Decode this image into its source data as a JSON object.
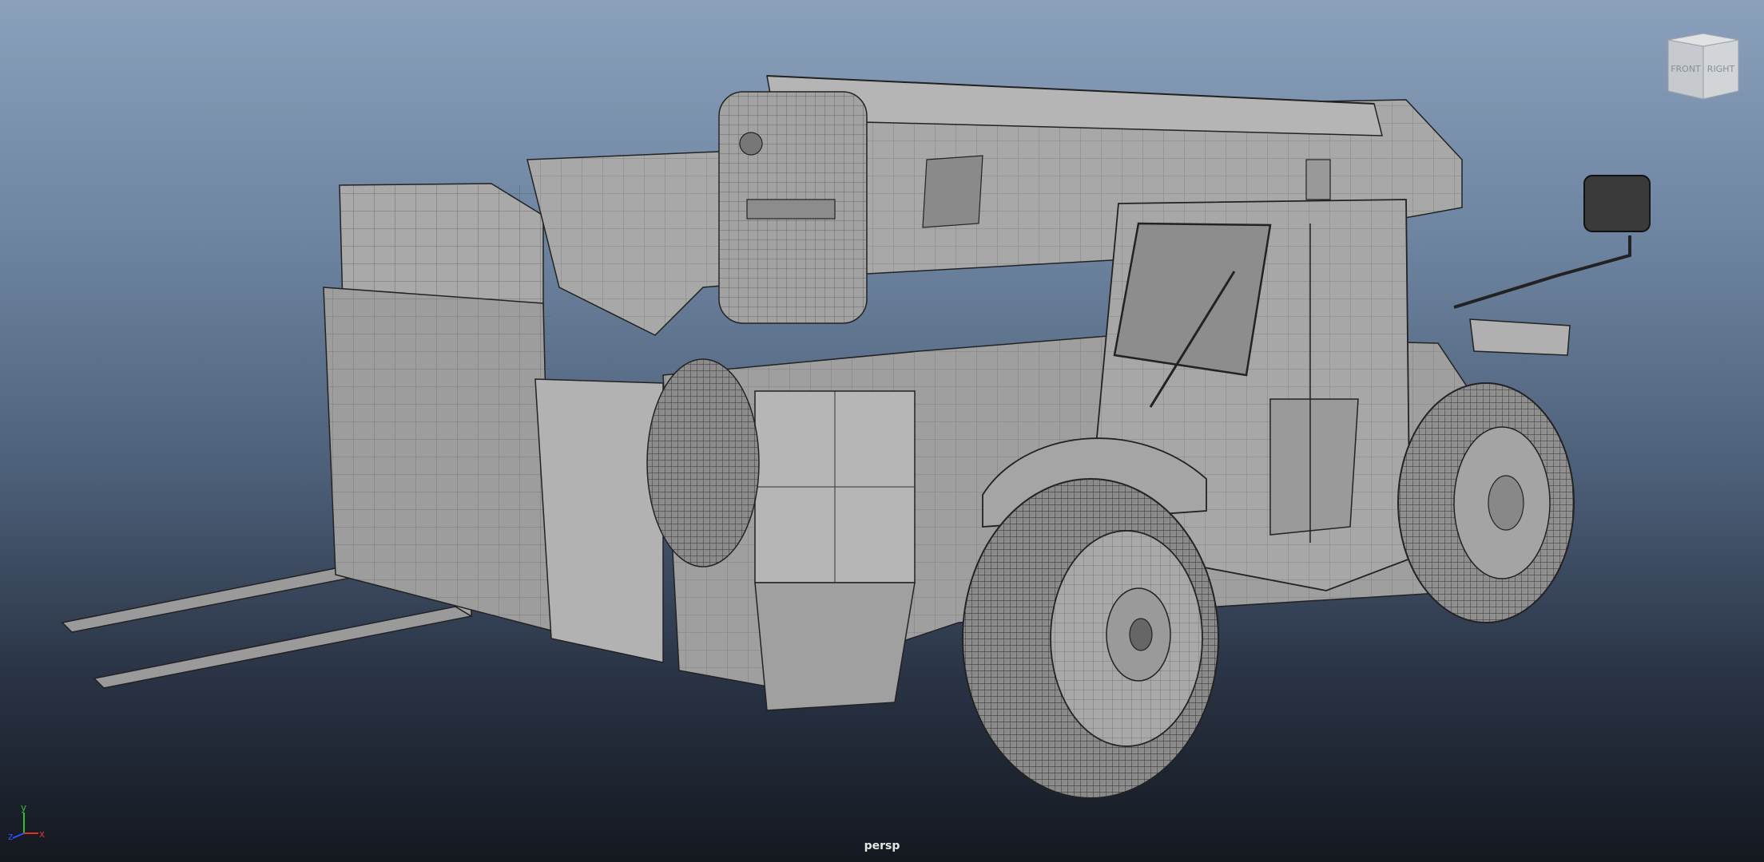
{
  "viewport": {
    "camera_name": "persp",
    "shading_mode": "wireframe-on-shaded",
    "background_colors": {
      "top": "#8aa0bb",
      "bottom": "#14181f"
    }
  },
  "view_cube": {
    "faces": {
      "front": "FRONT",
      "right": "RIGHT"
    }
  },
  "axis_indicator": {
    "x_label": "x",
    "y_label": "y",
    "z_label": "z",
    "x_color": "#e03030",
    "y_color": "#30c030",
    "z_color": "#3050ff"
  },
  "model": {
    "type": "telehandler",
    "icon": "telehandler-wireframe-model"
  }
}
